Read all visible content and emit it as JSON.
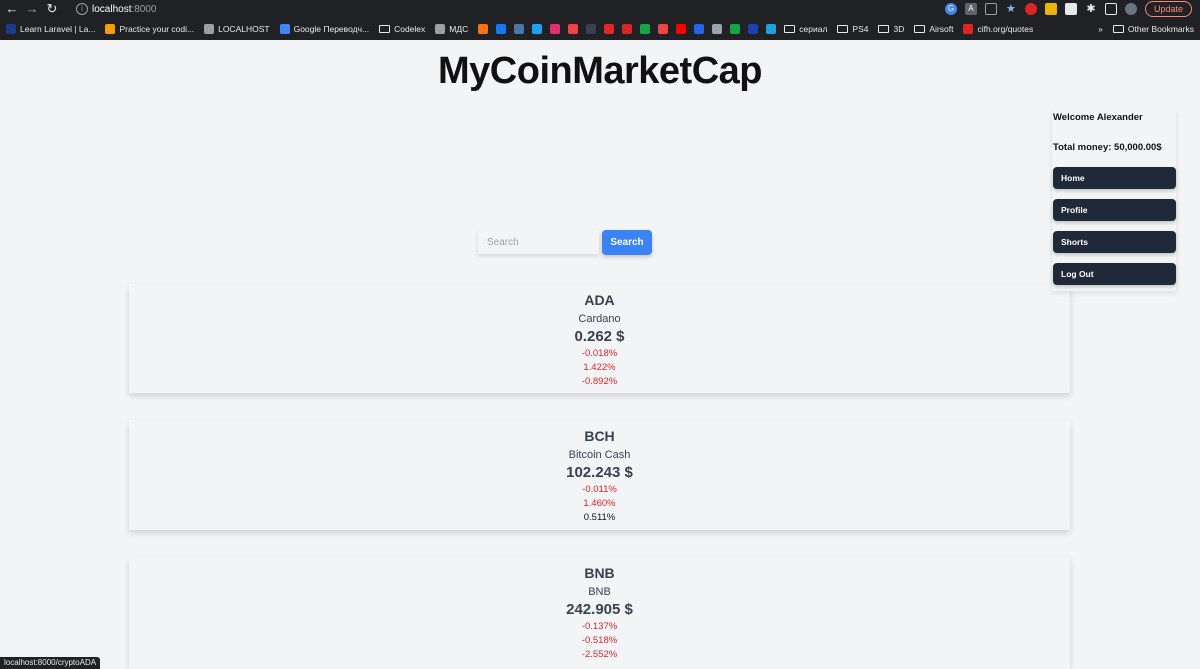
{
  "browser": {
    "url_host": "localhost",
    "url_port": ":8000",
    "update_label": "Update",
    "status_url": "localhost:8000/cryptoADA",
    "bookmarks": [
      {
        "label": "Learn Laravel | La...",
        "color": "#1e3a8a"
      },
      {
        "label": "Practice your codi...",
        "color": "#f59e0b"
      },
      {
        "label": "LOCALHOST",
        "color": "#9aa0a6"
      },
      {
        "label": "Google Переводч...",
        "color": "#4285f4"
      },
      {
        "label": "Codelex",
        "folder": true
      },
      {
        "label": "МДС",
        "color": "#9aa0a6"
      }
    ],
    "bookmark_icons": [
      {
        "name": "news-icon",
        "color": "#f97316"
      },
      {
        "name": "facebook-icon",
        "color": "#1877f2"
      },
      {
        "name": "vk-icon",
        "color": "#4a76a8"
      },
      {
        "name": "twitter-icon",
        "color": "#1da1f2"
      },
      {
        "name": "instagram-icon",
        "color": "#e1306c"
      },
      {
        "name": "mail-icon",
        "color": "#ef4444"
      },
      {
        "name": "k-icon",
        "color": "#374151"
      },
      {
        "name": "flipboard-icon",
        "color": "#e12828"
      },
      {
        "name": "lf-icon",
        "color": "#dc2626"
      },
      {
        "name": "flag-icon",
        "color": "#16a34a"
      },
      {
        "name": "pocket-icon",
        "color": "#ef4444"
      },
      {
        "name": "youtube-icon",
        "color": "#ff0000"
      },
      {
        "name": "info-icon",
        "color": "#2563eb"
      },
      {
        "name": "alien-icon",
        "color": "#9ca3af"
      },
      {
        "name": "ss-icon",
        "color": "#16a34a"
      },
      {
        "name": "seventeen-icon",
        "color": "#1e40af"
      },
      {
        "name": "telegram-icon",
        "color": "#229ed9"
      }
    ],
    "bookmarks_after": [
      {
        "label": "сериал",
        "folder": true
      },
      {
        "label": "PS4",
        "folder": true
      },
      {
        "label": "3D",
        "folder": true
      },
      {
        "label": "Airsoft",
        "folder": true
      },
      {
        "label": "cifh.org/quotes",
        "color": "#dc2626"
      }
    ],
    "more_bookmarks": "»",
    "other_bookmarks": "Other Bookmarks"
  },
  "page": {
    "title": "MyCoinMarketCap",
    "search_placeholder": "Search",
    "search_button": "Search"
  },
  "sidebar": {
    "welcome": "Welcome Alexander",
    "total_money": "Total money: 50,000.00$",
    "buttons": [
      "Home",
      "Profile",
      "Shorts",
      "Log Out"
    ]
  },
  "coins": [
    {
      "symbol": "ADA",
      "name": "Cardano",
      "price": "0.262 $",
      "changes": [
        {
          "value": "-0.018%",
          "negative": true
        },
        {
          "value": "1.422%",
          "negative": true
        },
        {
          "value": "-0.892%",
          "negative": true
        }
      ]
    },
    {
      "symbol": "BCH",
      "name": "Bitcoin Cash",
      "price": "102.243 $",
      "changes": [
        {
          "value": "-0.011%",
          "negative": true
        },
        {
          "value": "1.460%",
          "negative": true
        },
        {
          "value": "0.511%",
          "negative": false
        }
      ]
    },
    {
      "symbol": "BNB",
      "name": "BNB",
      "price": "242.905 $",
      "changes": [
        {
          "value": "-0.137%",
          "negative": true
        },
        {
          "value": "-0.518%",
          "negative": true
        },
        {
          "value": "-2.552%",
          "negative": true
        }
      ]
    }
  ],
  "colors": {
    "accent_blue": "#3b82f6",
    "sidebar_button": "#1f2937",
    "negative": "#dc2626"
  }
}
